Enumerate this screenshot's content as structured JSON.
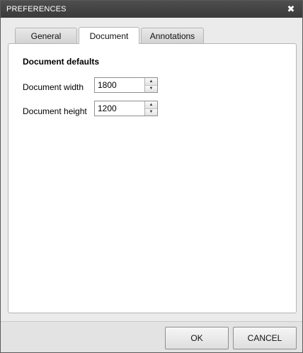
{
  "window": {
    "title": "PREFERENCES",
    "close_glyph": "✖"
  },
  "tabs": [
    {
      "label": "General",
      "active": false
    },
    {
      "label": "Document",
      "active": true
    },
    {
      "label": "Annotations",
      "active": false
    }
  ],
  "document_tab": {
    "section_title": "Document defaults",
    "fields": [
      {
        "label": "Document width",
        "value": "1800"
      },
      {
        "label": "Document height",
        "value": "1200"
      }
    ]
  },
  "footer": {
    "ok_label": "OK",
    "cancel_label": "CANCEL"
  },
  "icons": {
    "close": "close-icon",
    "spin_up": "chevron-up-icon",
    "spin_down": "chevron-down-icon"
  }
}
